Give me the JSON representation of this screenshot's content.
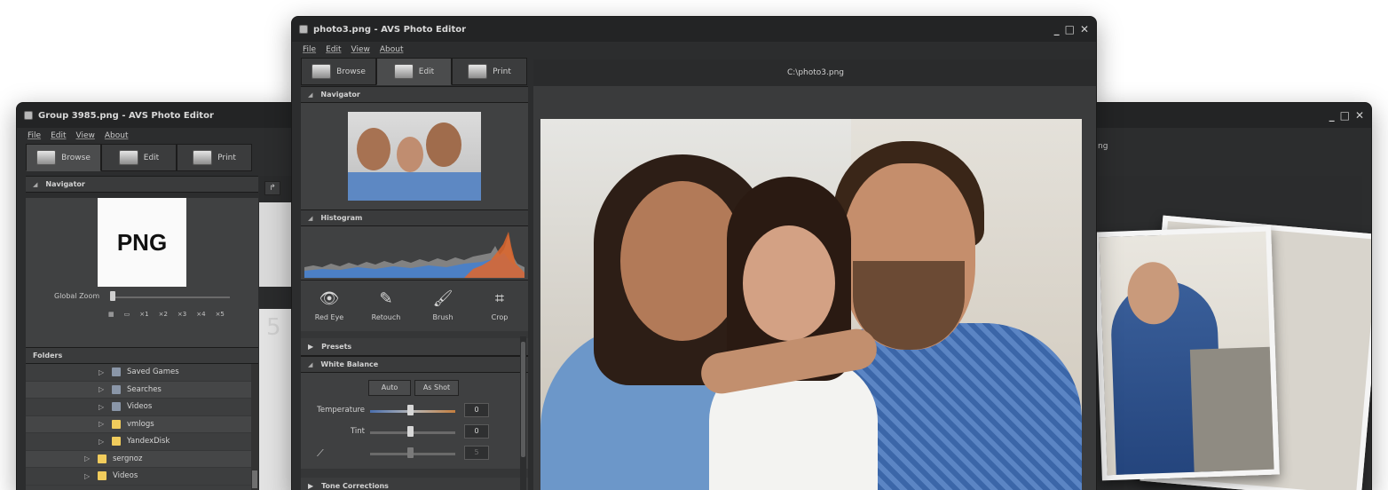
{
  "left_window": {
    "title": "Group 3985.png  -  AVS Photo Editor",
    "menu": [
      "File",
      "Edit",
      "View",
      "About"
    ],
    "tabs": [
      {
        "label": "Browse",
        "active": true
      },
      {
        "label": "Edit",
        "active": false
      },
      {
        "label": "Print",
        "active": false
      }
    ],
    "navigator_header": "Navigator",
    "thumbnail_text": "PNG",
    "global_zoom_label": "Global Zoom",
    "zoom_options": [
      "×1",
      "×2",
      "×3",
      "×4",
      "×5"
    ],
    "folders_header": "Folders",
    "folders": [
      {
        "name": "Saved Games",
        "icon": "saved-games-icon"
      },
      {
        "name": "Searches",
        "icon": "search-icon"
      },
      {
        "name": "Videos",
        "icon": "videos-icon"
      },
      {
        "name": "vmlogs",
        "icon": "folder-icon"
      },
      {
        "name": "YandexDisk",
        "icon": "folder-icon"
      },
      {
        "name": "sergnoz",
        "icon": "folder-icon"
      },
      {
        "name": "Videos",
        "icon": "folder-icon"
      }
    ],
    "strip_digit": "5"
  },
  "center_window": {
    "title": "photo3.png  -  AVS Photo Editor",
    "menu": [
      "File",
      "Edit",
      "View",
      "About"
    ],
    "tabs": [
      {
        "label": "Browse",
        "active": false
      },
      {
        "label": "Edit",
        "active": true
      },
      {
        "label": "Print",
        "active": false
      }
    ],
    "file_path": "C:\\photo3.png",
    "navigator_header": "Navigator",
    "histogram_header": "Histogram",
    "tools": [
      {
        "label": "Red Eye",
        "icon": "eye-icon"
      },
      {
        "label": "Retouch",
        "icon": "retouch-brush-icon"
      },
      {
        "label": "Brush",
        "icon": "paint-brush-icon"
      },
      {
        "label": "Crop",
        "icon": "crop-icon"
      }
    ],
    "presets_header": "Presets",
    "white_balance_header": "White Balance",
    "auto_label": "Auto",
    "as_shot_label": "As Shot",
    "temperature_label": "Temperature",
    "temperature_value": "0",
    "tint_label": "Tint",
    "tint_value": "0",
    "eyedropper_value": "5",
    "tone_corrections_header": "Tone Corrections"
  },
  "right_window": {
    "path_fragment": "ng"
  },
  "colors": {
    "window_bg": "#2c2d2e",
    "panel_bg": "#404142",
    "accent_hist_blue": "#3e7fd6",
    "accent_hist_orange": "#e0662a"
  }
}
